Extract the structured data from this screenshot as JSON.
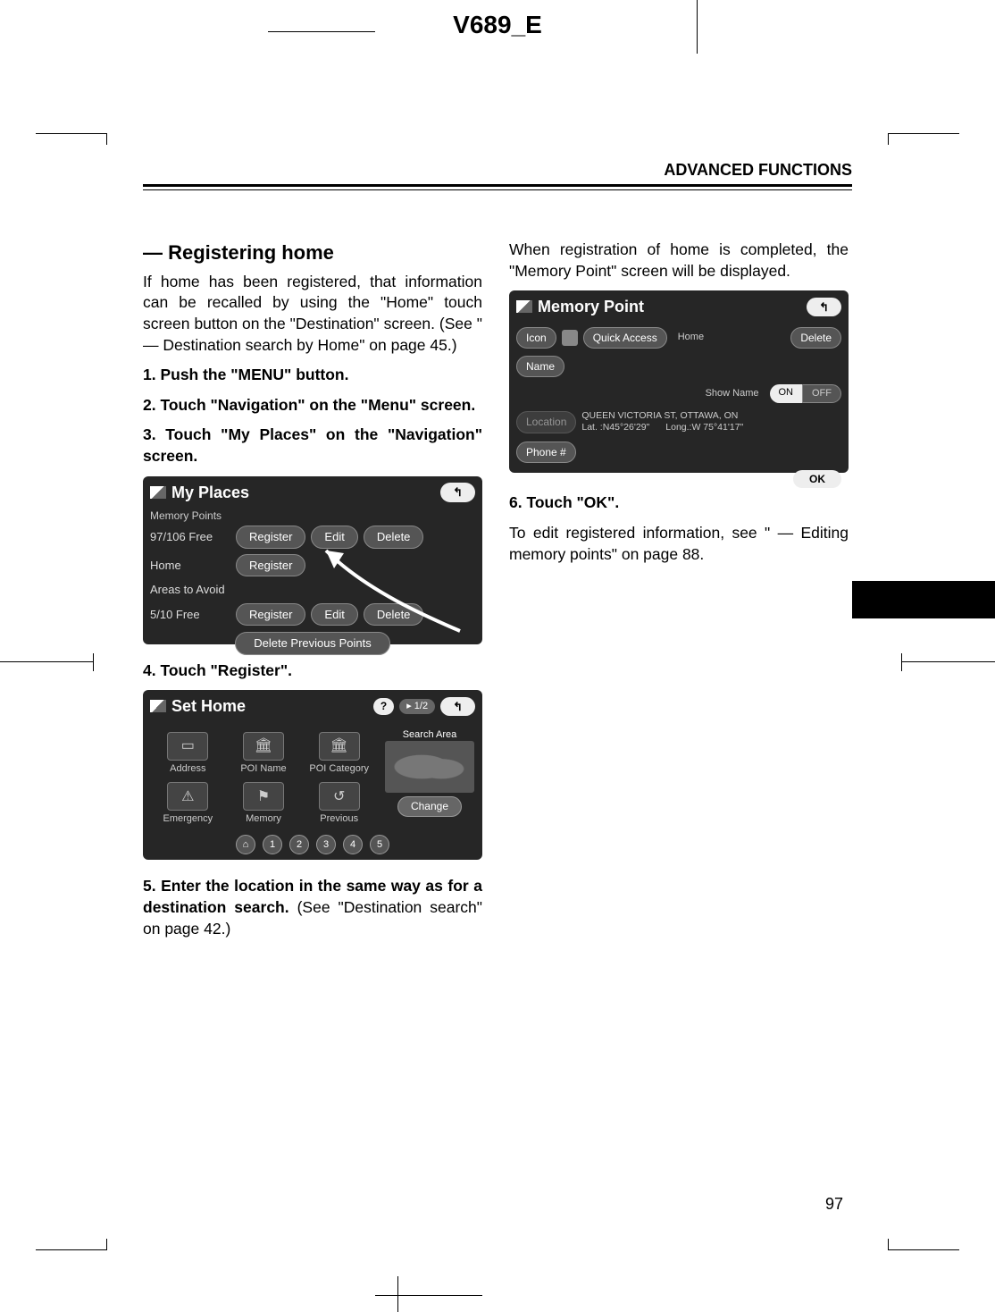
{
  "doc_header": "V689_E",
  "section_header": "ADVANCED FUNCTIONS",
  "page_number": "97",
  "left": {
    "title": "— Registering home",
    "intro": "If home has been registered, that information can be recalled by using the \"Home\" touch screen button on the \"Destination\" screen.   (See \" — Destination search by Home\" on page 45.)",
    "step1": "1.   Push the \"MENU\" button.",
    "step2": "2.  Touch  \"Navigation\"  on  the \"Menu\" screen.",
    "step3": "3.   Touch \"My Places\" on the \"Navigation\" screen.",
    "step4": "4.   Touch \"Register\".",
    "step5a": "5.  Enter the location in the same way as for a destination search.",
    "step5b": "   (See \"Destination search\" on page 42.)"
  },
  "right": {
    "intro": "When registration of home is completed, the \"Memory Point\" screen will be displayed.",
    "step6": "6.   Touch \"OK\".",
    "edit_ref": "To edit registered information, see \" — Editing memory points\" on page 88."
  },
  "ss1": {
    "title": "My Places",
    "sub": "Memory Points",
    "row1_label": "97/106 Free",
    "btn_register": "Register",
    "btn_edit": "Edit",
    "btn_delete": "Delete",
    "row2_label": "Home",
    "row3_label": "Areas to Avoid",
    "row4_label": "5/10 Free",
    "prev": "Delete Previous Points",
    "back": "↰"
  },
  "ss2": {
    "title": "Set Home",
    "help": "?",
    "page": "▸ 1/2",
    "back": "↰",
    "items_top": [
      "Address",
      "POI Name",
      "POI Category"
    ],
    "items_bot": [
      "Emergency",
      "Memory",
      "Previous"
    ],
    "search_area": "Search Area",
    "change": "Change",
    "nums": [
      "⌂",
      "1",
      "2",
      "3",
      "4",
      "5"
    ]
  },
  "ss3": {
    "title": "Memory Point",
    "back": "↰",
    "icon": "Icon",
    "quick": "Quick Access",
    "home": "Home",
    "delete": "Delete",
    "name": "Name",
    "show_name": "Show Name",
    "on": "ON",
    "off": "OFF",
    "location_label": "Location",
    "loc_text": "QUEEN VICTORIA ST, OTTAWA, ON",
    "lat": "Lat.  :N45°26'29\"",
    "lon": "Long.:W 75°41'17\"",
    "phone": "Phone #",
    "ok": "OK"
  }
}
